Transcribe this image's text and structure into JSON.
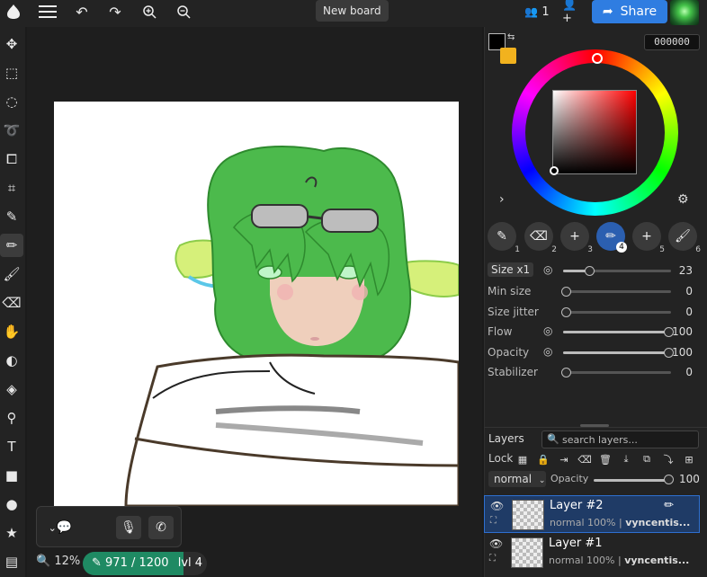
{
  "header": {
    "board_title": "New board",
    "participants_count": "1",
    "share_label": "Share"
  },
  "icons": {
    "logo": "app-logo-icon",
    "menu": "hamburger-menu-icon",
    "undo": "undo-icon",
    "redo": "redo-icon",
    "zoom_in": "zoom-in-icon",
    "zoom_out": "zoom-out-icon",
    "people": "people-icon",
    "add_user": "add-user-icon"
  },
  "tools": [
    {
      "name": "move-tool",
      "glyph": "✥"
    },
    {
      "name": "rect-select-tool",
      "glyph": "⬚"
    },
    {
      "name": "ellipse-select-tool",
      "glyph": "◌"
    },
    {
      "name": "lasso-tool",
      "glyph": "➰"
    },
    {
      "name": "transform-tool",
      "glyph": "⧠"
    },
    {
      "name": "crop-tool",
      "glyph": "⌗"
    },
    {
      "name": "eyedropper-tool",
      "glyph": "✎"
    },
    {
      "name": "pencil-tool",
      "glyph": "✏",
      "active": true
    },
    {
      "name": "brush-tool",
      "glyph": "🖌"
    },
    {
      "name": "eraser-tool",
      "glyph": "⌫"
    },
    {
      "name": "smudge-tool",
      "glyph": "✋"
    },
    {
      "name": "blur-tool",
      "glyph": "◐"
    },
    {
      "name": "fill-tool",
      "glyph": "◈"
    },
    {
      "name": "stamp-tool",
      "glyph": "⚲"
    },
    {
      "name": "text-tool",
      "glyph": "T"
    },
    {
      "name": "rectangle-shape-tool",
      "glyph": "■"
    },
    {
      "name": "ellipse-shape-tool",
      "glyph": "●"
    },
    {
      "name": "star-shape-tool",
      "glyph": "★"
    },
    {
      "name": "frames-tool",
      "glyph": "▤"
    }
  ],
  "status": {
    "zoom": "12%",
    "xp": "971 / 1200",
    "xp_fraction": 0.809,
    "level": "lvl 4"
  },
  "color": {
    "hex": "000000",
    "primary": "#000000",
    "secondary": "#f2b21e"
  },
  "brush_presets": [
    {
      "glyph": "✎",
      "number": "1"
    },
    {
      "glyph": "⌫",
      "number": "2"
    },
    {
      "glyph": "+",
      "number": "3"
    },
    {
      "glyph": "✏",
      "number": "4",
      "selected": true
    },
    {
      "glyph": "+",
      "number": "5"
    },
    {
      "glyph": "🖌",
      "number": "6"
    }
  ],
  "brush": {
    "size_label": "Size x1",
    "size_value": "23",
    "size_fraction": 0.24,
    "min_size_label": "Min size",
    "min_size_value": "0",
    "size_jitter_label": "Size jitter",
    "size_jitter_value": "0",
    "flow_label": "Flow",
    "flow_value": "100",
    "opacity_label": "Opacity",
    "opacity_value": "100",
    "stabilizer_label": "Stabilizer",
    "stabilizer_value": "0"
  },
  "layers": {
    "title": "Layers",
    "search_placeholder": "search layers...",
    "lock_label": "Lock",
    "blend_mode": "normal",
    "opacity_label": "Opacity",
    "opacity_value": "100",
    "items": [
      {
        "name": "Layer #2",
        "blend": "normal 100%",
        "owner": "vyncentis...",
        "selected": true
      },
      {
        "name": "Layer #1",
        "blend": "normal 100%",
        "owner": "vyncentis...",
        "selected": false
      }
    ]
  }
}
